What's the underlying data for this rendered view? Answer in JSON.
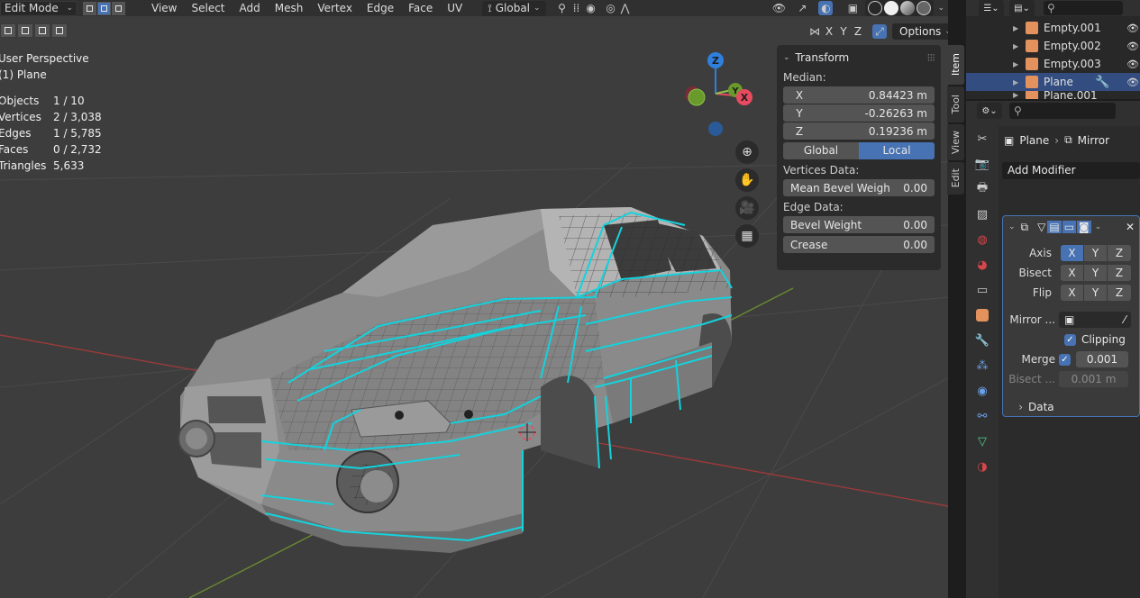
{
  "header": {
    "mode": "Edit Mode",
    "menus": [
      "View",
      "Select",
      "Add",
      "Mesh",
      "Vertex",
      "Edge",
      "Face",
      "UV"
    ],
    "transform_orientation": "Global",
    "options_label": "Options",
    "axis_toggles": [
      "X",
      "Y",
      "Z"
    ]
  },
  "overlay": {
    "view_name": "User Perspective",
    "object_name": "(1) Plane",
    "stats": [
      {
        "label": "Objects",
        "value": "1 / 10"
      },
      {
        "label": "Vertices",
        "value": "2 / 3,038"
      },
      {
        "label": "Edges",
        "value": "1 / 5,785"
      },
      {
        "label": "Faces",
        "value": "0 / 2,732"
      },
      {
        "label": "Triangles",
        "value": "5,633"
      }
    ]
  },
  "gizmo": {
    "x": "X",
    "y": "Y",
    "z": "Z"
  },
  "npanel": {
    "title": "Transform",
    "median_label": "Median:",
    "fields": [
      {
        "axis": "X",
        "value": "0.84423 m"
      },
      {
        "axis": "Y",
        "value": "-0.26263 m"
      },
      {
        "axis": "Z",
        "value": "0.19236 m"
      }
    ],
    "space": {
      "global": "Global",
      "local": "Local"
    },
    "vertices_data_label": "Vertices Data:",
    "mean_bevel": {
      "label": "Mean Bevel Weigh",
      "value": "0.00"
    },
    "edge_data_label": "Edge Data:",
    "bevel_weight": {
      "label": "Bevel Weight",
      "value": "0.00"
    },
    "crease": {
      "label": "Crease",
      "value": "0.00"
    },
    "tabs": [
      "Item",
      "Tool",
      "View",
      "Edit"
    ]
  },
  "outliner": {
    "rows": [
      "Empty.001",
      "Empty.002",
      "Empty.003",
      "Plane",
      "Plane.001"
    ]
  },
  "properties": {
    "breadcrumb": {
      "object": "Plane",
      "modifier": "Mirror"
    },
    "add_modifier": "Add Modifier",
    "mirror": {
      "axis_label": "Axis",
      "bisect_label": "Bisect",
      "flip_label": "Flip",
      "xyz": [
        "X",
        "Y",
        "Z"
      ],
      "mirror_object_label": "Mirror ...",
      "clipping_label": "Clipping",
      "merge_label": "Merge",
      "merge_value": "0.001",
      "bisect_distance_label": "Bisect ...",
      "bisect_distance_value": "0.001 m",
      "data_label": "Data"
    }
  },
  "colors": {
    "accent": "#4772b3",
    "edge_highlight": "#14d2dc",
    "axis_x": "#e84a5f",
    "axis_y": "#8bc34a",
    "axis_z": "#2f7fdd"
  }
}
